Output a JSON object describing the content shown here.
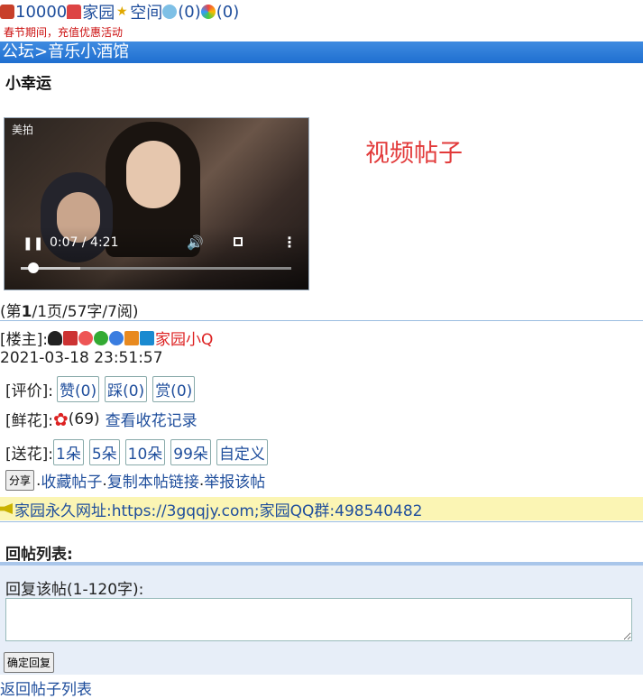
{
  "topbar": {
    "coins": "10000",
    "home": "家园",
    "space": "空间",
    "messages": "(0)",
    "notices": "(0)"
  },
  "promo": "春节期间，充值优惠活动",
  "breadcrumb": {
    "forum": "公坛",
    "sep": ">",
    "board": "音乐小酒馆"
  },
  "post": {
    "title": "小幸运",
    "video": {
      "watermark": "美拍",
      "time": "0:07 / 4:21",
      "progress": 0.027
    },
    "overlay_label": "视频帖子",
    "page_info_prefix": "(第",
    "page_current": "1",
    "page_info_suffix": "/1页/57字/7阅)",
    "owner_label": "[楼主]:",
    "owner_name": "家园小Q",
    "date": "2021-03-18 23:51:57",
    "rating_label": "[评价]:",
    "like": "赞(0)",
    "dislike": "踩(0)",
    "tip": "赏(0)",
    "flowers_label": "[鲜花]:",
    "flowers_count": "(69)",
    "flowers_link": "查看收花记录",
    "send_label": "[送花]:",
    "send_options": [
      "1朵",
      "5朵",
      "10朵",
      "99朵",
      "自定义"
    ],
    "share_btn": "分享",
    "actions": [
      ".",
      "收藏帖子",
      ".",
      "复制本帖链接",
      ".",
      "举报该帖"
    ]
  },
  "notice": "家园永久网址:https://3gqqjy.com;家园QQ群:498540482",
  "replies": {
    "heading": "回帖列表:",
    "form_label": "回复该帖(1-120字):",
    "input_value": "",
    "submit": "确定回复"
  },
  "back_link": "返回帖子列表"
}
